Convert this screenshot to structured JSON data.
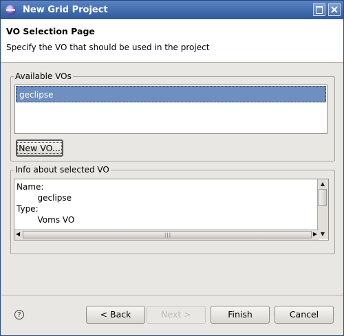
{
  "window": {
    "title": "New Grid Project"
  },
  "header": {
    "title": "VO Selection Page",
    "description": "Specify the VO that should be used in the project"
  },
  "available_vos": {
    "label": "Available VOs",
    "items": [
      "geclipse"
    ],
    "selected": "geclipse",
    "new_button_label": "New VO..."
  },
  "info": {
    "label": "Info about selected VO",
    "lines": [
      {
        "text": "Name:"
      },
      {
        "text": "geclipse"
      },
      {
        "text": "Type:"
      },
      {
        "text": "Voms VO"
      }
    ]
  },
  "buttons": {
    "back": "< Back",
    "next": "Next >",
    "finish": "Finish",
    "cancel": "Cancel"
  },
  "colors": {
    "title_bar": "#3d6ab0",
    "selection": "#6e8fbf",
    "dialog_bg": "#e9e7e3"
  }
}
